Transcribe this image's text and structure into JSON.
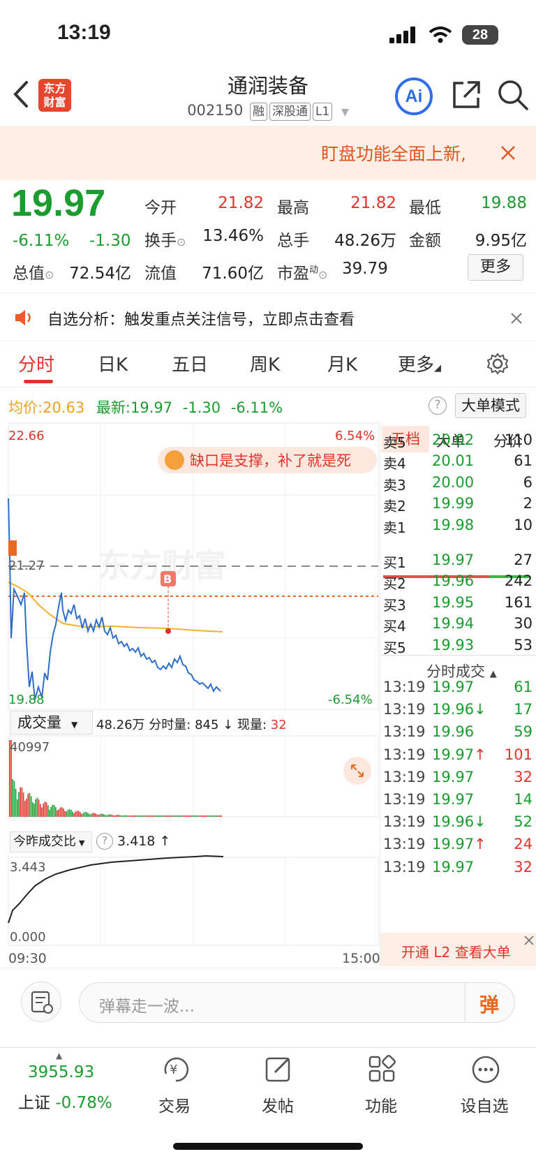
{
  "status_bar": {
    "time": "13:19",
    "battery": "28"
  },
  "header": {
    "title": "通润装备",
    "code": "002150",
    "tags": [
      "融",
      "深股通",
      "L1"
    ],
    "logo": "东方\n财富",
    "ai_label": "Ai"
  },
  "banner": {
    "text": "盯盘功能全面上新,"
  },
  "quote": {
    "price": "19.97",
    "change_pct": "-6.11%",
    "change": "-1.30",
    "open_label": "今开",
    "open": "21.82",
    "high_label": "最高",
    "high": "21.82",
    "low_label": "最低",
    "low": "19.88",
    "turnover_label": "换手",
    "turnover": "13.46%",
    "volume_label": "总手",
    "volume": "48.26万",
    "amount_label": "金额",
    "amount": "9.95亿",
    "mktcap_label": "总值",
    "mktcap": "72.54亿",
    "float_label": "流值",
    "float": "71.60亿",
    "pe_label": "市盈",
    "pe_sup": "动",
    "pe": "39.79",
    "more_label": "更多"
  },
  "alert": {
    "text": "自选分析：触发重点关注信号，立即点击查看"
  },
  "tabs": [
    "分时",
    "日K",
    "五日",
    "周K",
    "月K",
    "更多"
  ],
  "chart_header": {
    "avg_label": "均价:",
    "avg": "20.63",
    "latest_label": "最新:",
    "latest": "19.97",
    "change": "-1.30",
    "change_pct": "-6.11%",
    "mode_button": "大单模式"
  },
  "chart_labels": {
    "top_price": "22.66",
    "top_pct": "6.54%",
    "mid_price": "21.27",
    "bottom_price": "19.88",
    "bottom_pct": "-6.54%",
    "bubble": "缺口是支撑，补了就是死",
    "watermark": "东方财富",
    "b_marker": "B"
  },
  "volume_panel": {
    "selector": "成交量",
    "total": "48.26万",
    "minute_label": "分时量:",
    "minute": "845",
    "now_label": "现量:",
    "now": "32",
    "max": "40997"
  },
  "ratio_panel": {
    "selector": "今昨成交比",
    "value": "3.418",
    "top": "3.443",
    "bottom": "0.000"
  },
  "time_axis": {
    "start": "09:30",
    "end": "15:00"
  },
  "orderbook": {
    "tabs": [
      "五档",
      "大单",
      "分价"
    ],
    "asks": [
      {
        "label": "卖5",
        "price": "20.02",
        "vol": "110"
      },
      {
        "label": "卖4",
        "price": "20.01",
        "vol": "61"
      },
      {
        "label": "卖3",
        "price": "20.00",
        "vol": "6"
      },
      {
        "label": "卖2",
        "price": "19.99",
        "vol": "2"
      },
      {
        "label": "卖1",
        "price": "19.98",
        "vol": "10"
      }
    ],
    "bids": [
      {
        "label": "买1",
        "price": "19.97",
        "vol": "27"
      },
      {
        "label": "买2",
        "price": "19.96",
        "vol": "242"
      },
      {
        "label": "买3",
        "price": "19.95",
        "vol": "161"
      },
      {
        "label": "买4",
        "price": "19.94",
        "vol": "30"
      },
      {
        "label": "买5",
        "price": "19.93",
        "vol": "53"
      }
    ],
    "trades_title": "分时成交",
    "trades": [
      {
        "t": "13:19",
        "p": "19.97",
        "v": "61",
        "dir": ""
      },
      {
        "t": "13:19",
        "p": "19.96",
        "v": "17",
        "dir": "↓"
      },
      {
        "t": "13:19",
        "p": "19.96",
        "v": "59",
        "dir": ""
      },
      {
        "t": "13:19",
        "p": "19.97",
        "v": "101",
        "dir": "↑"
      },
      {
        "t": "13:19",
        "p": "19.97",
        "v": "32",
        "dir": ""
      },
      {
        "t": "13:19",
        "p": "19.97",
        "v": "14",
        "dir": ""
      },
      {
        "t": "13:19",
        "p": "19.96",
        "v": "52",
        "dir": "↓"
      },
      {
        "t": "13:19",
        "p": "19.97",
        "v": "24",
        "dir": "↑"
      },
      {
        "t": "13:19",
        "p": "19.97",
        "v": "32",
        "dir": ""
      }
    ],
    "l2_promo": "开通 L2 查看大单"
  },
  "danmu": {
    "placeholder": "弹幕走一波...",
    "button": "弹"
  },
  "bottom_nav": {
    "index_value": "3955.93",
    "index_name": "上证",
    "index_change": "-0.78%",
    "items": [
      "交易",
      "发帖",
      "功能",
      "设自选"
    ]
  }
}
